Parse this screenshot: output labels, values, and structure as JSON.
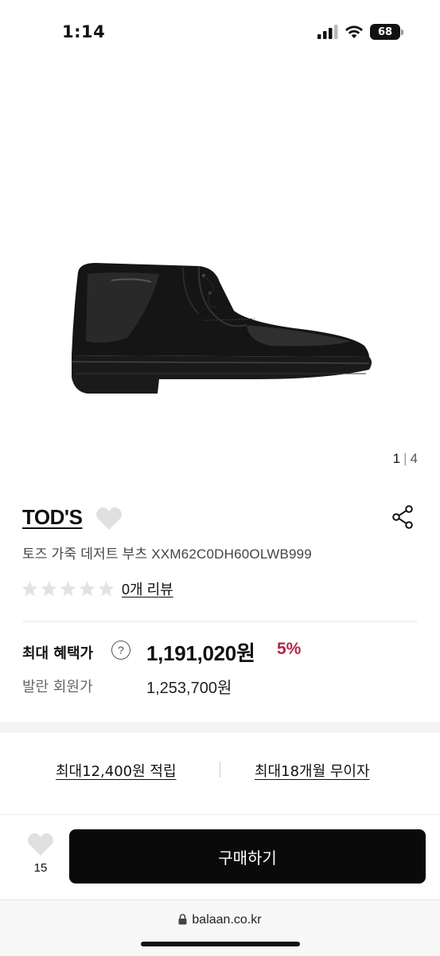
{
  "status_bar": {
    "time": "1:14",
    "battery": "68"
  },
  "gallery": {
    "current": "1",
    "separator": "|",
    "total": "4"
  },
  "product": {
    "brand": "TOD'S",
    "name": "토즈 가죽 데저트 부츠 XXM62C0DH60OLWB999",
    "rating": 0,
    "review_link": "0개 리뷰"
  },
  "price": {
    "label": "최대 혜택가",
    "help": "?",
    "value": "1,191,020원",
    "discount": "5%",
    "member_label": "발란 회원가",
    "member_value": "1,253,700원"
  },
  "benefits": {
    "points": "최대12,400원 적립",
    "installment": "최대18개월 무이자"
  },
  "action_bar": {
    "wish_count": "15",
    "buy_label": "구매하기"
  },
  "browser": {
    "url": "balaan.co.kr"
  },
  "colors": {
    "discount": "#b2264c",
    "buy_button": "#0a0a0a",
    "star_empty": "#e3e3e3",
    "heart": "#e0e0e0"
  }
}
